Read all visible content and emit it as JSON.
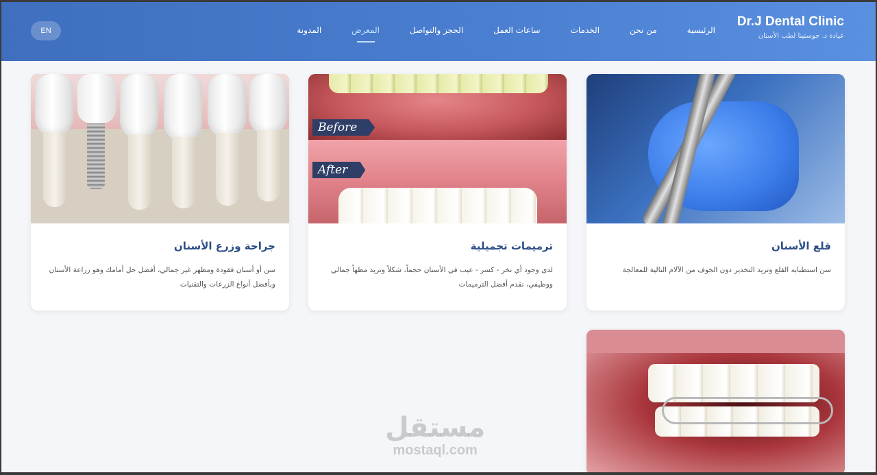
{
  "header": {
    "brand_title": "Dr.J Dental Clinic",
    "brand_subtitle": "عيادة د. جوستينا لطب الأسنان",
    "nav": [
      {
        "label": "الرئيسية",
        "active": false
      },
      {
        "label": "من نحن",
        "active": false
      },
      {
        "label": "الخدمات",
        "active": false
      },
      {
        "label": "ساعات العمل",
        "active": false
      },
      {
        "label": "الحجز والتواصل",
        "active": false
      },
      {
        "label": "المعرض",
        "active": true
      },
      {
        "label": "المدونة",
        "active": false
      }
    ],
    "lang_button": "EN"
  },
  "gallery": {
    "cards": [
      {
        "title": "قلع الأسنان",
        "description": "سن استطبابه القلع وتريد التخدير دون الخوف من الآلام التالية للمعالجة"
      },
      {
        "title": "ترميمات تجميلية",
        "description": "لدى وجود أي نخر - كسر - عيب في الأسنان حجماً، شكلاً وتريد مظهاً جمالي ووظيفي، نقدم أفضل الترميمات",
        "before_label": "Before",
        "after_label": "After"
      },
      {
        "title": "جراحة وزرع الأسنان",
        "description": "سن أو أسنان فقودة ومظهر غير جمالي، أفضل حل أمامك وهو زراعة الأسنان وبأفضل أنواع الزرعات والتقنيات"
      }
    ]
  },
  "watermark": {
    "arabic": "مستقل",
    "latin": "mostaql.com"
  },
  "colors": {
    "header_start": "#3f6fbe",
    "header_end": "#5a90e0",
    "card_title": "#2d4e86",
    "active_nav": "#bfe0ff"
  }
}
